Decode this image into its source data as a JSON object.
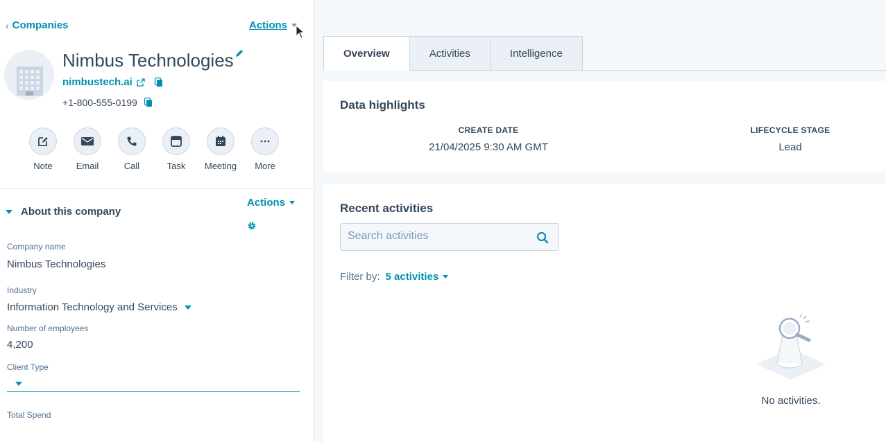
{
  "colors": {
    "accent": "#0091ae",
    "text": "#33475b",
    "border": "#cbd6e2",
    "panel_bg": "#f5f8fa"
  },
  "nav": {
    "back_label": "Companies",
    "actions_label": "Actions"
  },
  "record": {
    "name": "Nimbus Technologies",
    "domain": "nimbustech.ai",
    "phone": "+1-800-555-0199"
  },
  "quick_actions": [
    {
      "label": "Note",
      "icon": "note-icon"
    },
    {
      "label": "Email",
      "icon": "email-icon"
    },
    {
      "label": "Call",
      "icon": "call-icon"
    },
    {
      "label": "Task",
      "icon": "task-icon"
    },
    {
      "label": "Meeting",
      "icon": "meeting-icon"
    },
    {
      "label": "More",
      "icon": "more-icon"
    }
  ],
  "about": {
    "title": "About this company",
    "actions_label": "Actions",
    "fields": {
      "company_name": {
        "label": "Company name",
        "value": "Nimbus Technologies"
      },
      "industry": {
        "label": "Industry",
        "value": "Information Technology and Services"
      },
      "employees": {
        "label": "Number of employees",
        "value": "4,200"
      },
      "client_type": {
        "label": "Client Type",
        "value": ""
      },
      "total_spend": {
        "label": "Total Spend",
        "value": ""
      }
    }
  },
  "tabs": [
    {
      "label": "Overview",
      "active": true
    },
    {
      "label": "Activities",
      "active": false
    },
    {
      "label": "Intelligence",
      "active": false
    }
  ],
  "highlights": {
    "title": "Data highlights",
    "create_date": {
      "label": "CREATE DATE",
      "value": "21/04/2025 9:30 AM GMT"
    },
    "lifecycle": {
      "label": "LIFECYCLE STAGE",
      "value": "Lead"
    }
  },
  "activities": {
    "title": "Recent activities",
    "search_placeholder": "Search activities",
    "filter_label": "Filter by:",
    "filter_value": "5 activities",
    "empty_text": "No activities."
  }
}
